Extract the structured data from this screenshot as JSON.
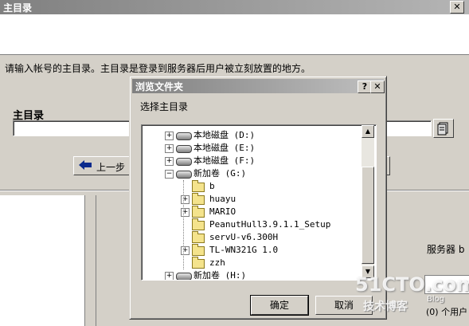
{
  "wizard": {
    "title": "主目录",
    "close_glyph": "✕",
    "instruction": "请输入帐号的主目录。主目录是登录到服务器后用户被立刻放置的地方。",
    "homedir_label": "主目录",
    "homedir_value": "",
    "prev_label": "上一步",
    "server_label": "服务器 b",
    "status_text": "(0) 个用户"
  },
  "dialog": {
    "title": "浏览文件夹",
    "help_glyph": "?",
    "close_glyph": "✕",
    "prompt": "选择主目录",
    "ok_label": "确定",
    "cancel_label": "取消"
  },
  "tree": {
    "items": [
      {
        "label": "本地磁盘 (D:)",
        "type": "drive",
        "expander": "+",
        "level": 0
      },
      {
        "label": "本地磁盘 (E:)",
        "type": "drive",
        "expander": "+",
        "level": 0
      },
      {
        "label": "本地磁盘 (F:)",
        "type": "drive",
        "expander": "+",
        "level": 0
      },
      {
        "label": "新加卷 (G:)",
        "type": "drive",
        "expander": "−",
        "level": 0
      },
      {
        "label": "b",
        "type": "folder",
        "expander": "",
        "level": 1
      },
      {
        "label": "huayu",
        "type": "folder",
        "expander": "+",
        "level": 1
      },
      {
        "label": "MARIO",
        "type": "folder",
        "expander": "+",
        "level": 1
      },
      {
        "label": "PeanutHull3.9.1.1_Setup",
        "type": "folder",
        "expander": "",
        "level": 1
      },
      {
        "label": "servU-v6.300H",
        "type": "folder",
        "expander": "",
        "level": 1
      },
      {
        "label": "TL-WN321G 1.0",
        "type": "folder",
        "expander": "+",
        "level": 1
      },
      {
        "label": "zzh",
        "type": "folder",
        "expander": "",
        "level": 1
      },
      {
        "label": "新加卷 (H:)",
        "type": "drive",
        "expander": "+",
        "level": 0
      }
    ],
    "scroll_up_glyph": "▲",
    "scroll_down_glyph": "▼"
  },
  "watermark": {
    "line1": "51CTO.com",
    "line2": "技术博客",
    "line3": "Blog"
  }
}
